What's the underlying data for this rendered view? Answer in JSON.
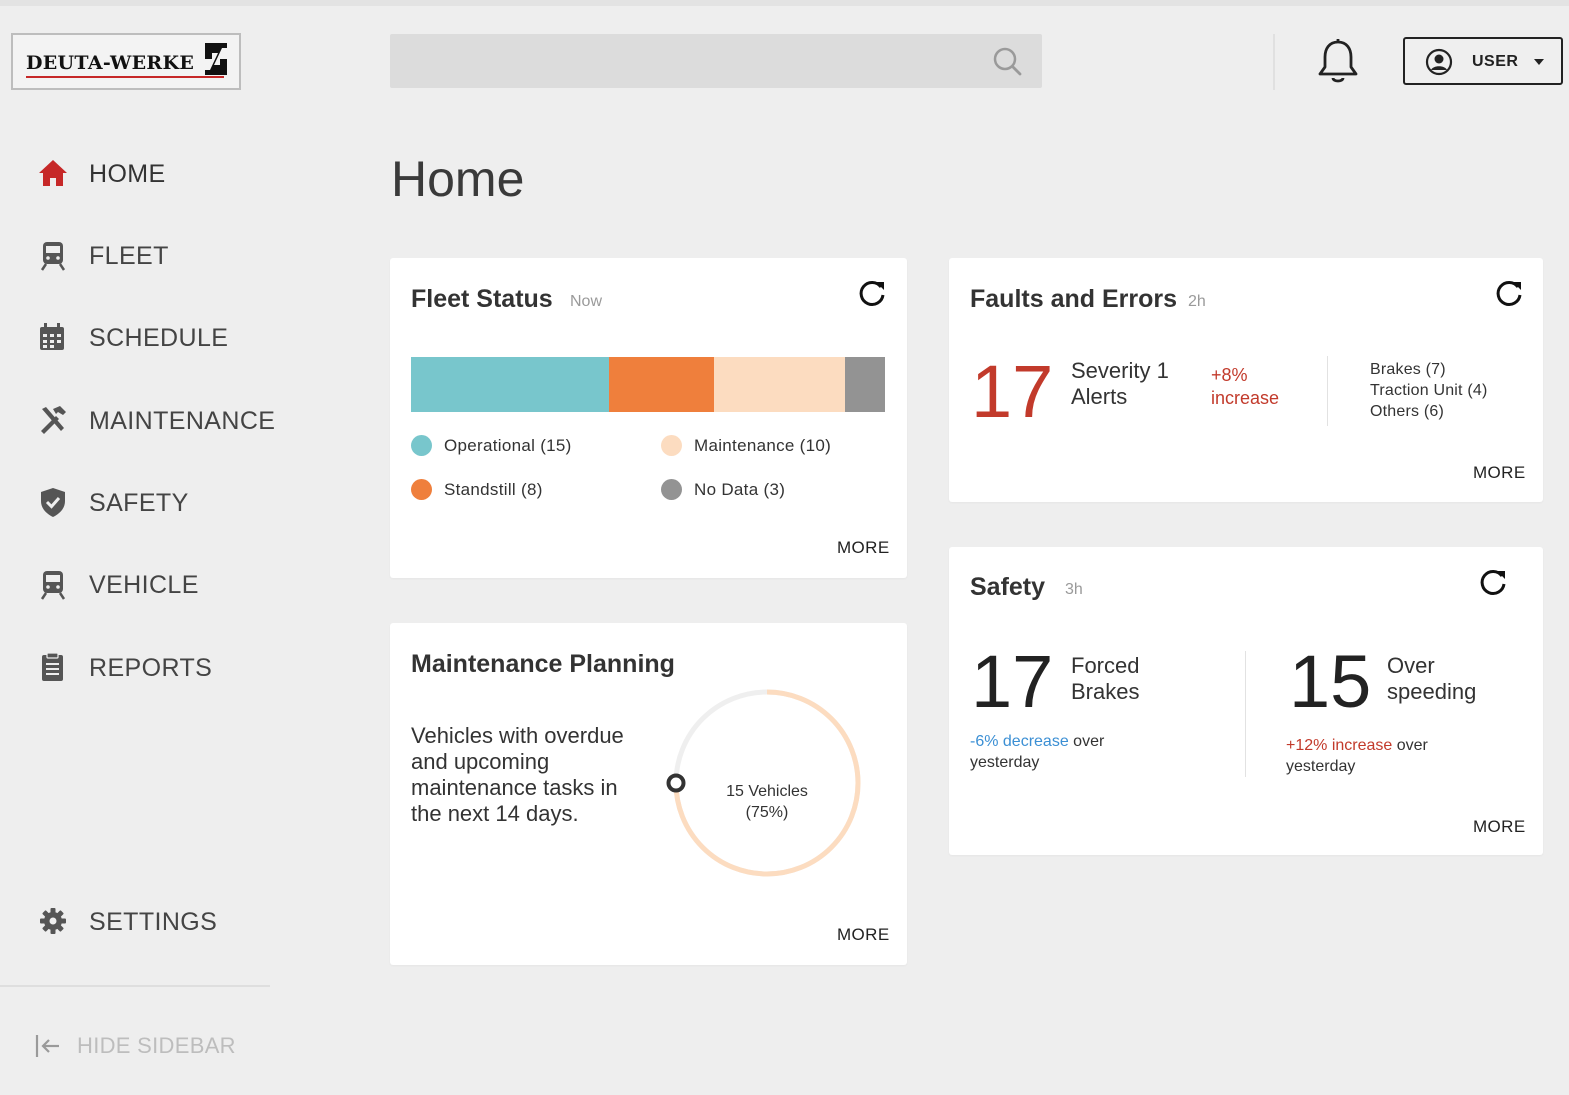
{
  "brand": {
    "logo_text": "DEUTA-WERKE",
    "accent_color": "#c62828"
  },
  "header": {
    "search": {
      "placeholder": "",
      "value": ""
    },
    "user_label": "USER"
  },
  "sidebar": {
    "items": [
      {
        "label": "HOME",
        "icon": "home-icon",
        "active": true
      },
      {
        "label": "FLEET",
        "icon": "train-icon"
      },
      {
        "label": "SCHEDULE",
        "icon": "calendar-icon"
      },
      {
        "label": "MAINTENANCE",
        "icon": "tools-icon"
      },
      {
        "label": "SAFETY",
        "icon": "shield-check-icon"
      },
      {
        "label": "VEHICLE",
        "icon": "train-icon"
      },
      {
        "label": "REPORTS",
        "icon": "clipboard-icon"
      }
    ],
    "settings_label": "SETTINGS",
    "hide_label": "HIDE SIDEBAR"
  },
  "page": {
    "title": "Home"
  },
  "fleet_status": {
    "title": "Fleet Status",
    "time": "Now",
    "more": "MORE",
    "segments": [
      {
        "label": "Operational (15)",
        "value": 15,
        "color": "#78c6cc"
      },
      {
        "label": "Standstill (8)",
        "value": 8,
        "color": "#ef7f3c"
      },
      {
        "label": "Maintenance (10)",
        "value": 10,
        "color": "#fcdcc0"
      },
      {
        "label": "No Data (3)",
        "value": 3,
        "color": "#939393"
      }
    ]
  },
  "faults": {
    "title": "Faults and Errors",
    "time": "2h",
    "number": "17",
    "label_line1": "Severity 1",
    "label_line2": "Alerts",
    "trend_line1": "+8%",
    "trend_line2": "increase",
    "breakdown": [
      "Brakes (7)",
      "Traction Unit (4)",
      "Others (6)"
    ],
    "more": "MORE"
  },
  "maintenance_planning": {
    "title": "Maintenance Planning",
    "description": "Vehicles with overdue and upcoming maintenance tasks in the next 14 days.",
    "donut_line1": "15 Vehicles",
    "donut_line2": "(75%)",
    "percent": 75,
    "more": "MORE"
  },
  "safety": {
    "title": "Safety",
    "time": "3h",
    "forced_brakes": {
      "number": "17",
      "label_line1": "Forced",
      "label_line2": "Brakes",
      "trend_value": "-6% decrease",
      "trend_rest": " over",
      "trend_line2": "yesterday"
    },
    "over_speeding": {
      "number": "15",
      "label_line1": "Over",
      "label_line2": "speeding",
      "trend_value": "+12% increase",
      "trend_rest": " over",
      "trend_line2": "yesterday"
    },
    "more": "MORE"
  }
}
